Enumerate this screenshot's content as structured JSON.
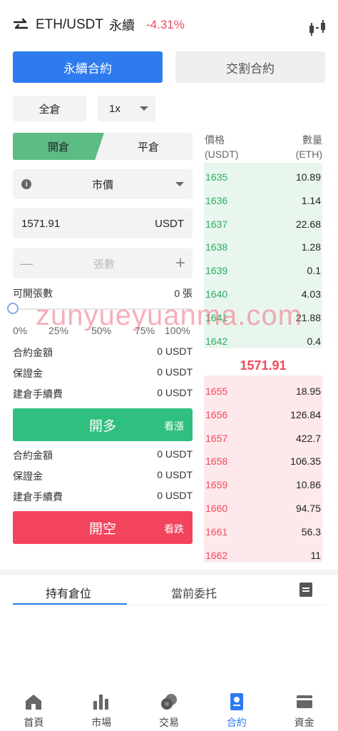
{
  "header": {
    "pair": "ETH/USDT",
    "contract_type": "永續",
    "change": "-4.31%",
    "change_color": "#f04a5a"
  },
  "contract_tabs": [
    {
      "label": "永續合約",
      "active": true
    },
    {
      "label": "交割合約",
      "active": false
    }
  ],
  "margin_mode": "全倉",
  "leverage": "1x",
  "position_toggle": {
    "open": "開倉",
    "close": "平倉"
  },
  "order_type": "市價",
  "price_input": {
    "value": "1571.91",
    "unit": "USDT"
  },
  "quantity_input": {
    "placeholder": "張數",
    "minus": "—",
    "plus": "+"
  },
  "available": {
    "label": "可開張數",
    "value": "0 張"
  },
  "slider": {
    "percentages": [
      "0%",
      "25%",
      "50%",
      "75%",
      "100%"
    ],
    "value": 0
  },
  "long_summary": [
    {
      "label": "合約金額",
      "value": "0 USDT"
    },
    {
      "label": "保證金",
      "value": "0 USDT"
    },
    {
      "label": "建倉手續費",
      "value": "0 USDT"
    }
  ],
  "long_button": {
    "label": "開多",
    "sub": "看漲",
    "color": "#2fbf7e"
  },
  "short_summary": [
    {
      "label": "合約金額",
      "value": "0 USDT"
    },
    {
      "label": "保證金",
      "value": "0 USDT"
    },
    {
      "label": "建倉手續費",
      "value": "0 USDT"
    }
  ],
  "short_button": {
    "label": "開空",
    "sub": "看跌",
    "color": "#f04a5a"
  },
  "orderbook": {
    "price_header": "價格",
    "price_unit": "(USDT)",
    "qty_header": "數量",
    "qty_unit": "(ETH)",
    "asks": [
      {
        "price": "1635",
        "qty": "10.89"
      },
      {
        "price": "1636",
        "qty": "1.14"
      },
      {
        "price": "1637",
        "qty": "22.68"
      },
      {
        "price": "1638",
        "qty": "1.28"
      },
      {
        "price": "1639",
        "qty": "0.1"
      },
      {
        "price": "1640",
        "qty": "4.03"
      },
      {
        "price": "1641",
        "qty": "21.88"
      },
      {
        "price": "1642",
        "qty": "0.4"
      }
    ],
    "mid_price": "1571.91",
    "bids": [
      {
        "price": "1655",
        "qty": "18.95"
      },
      {
        "price": "1656",
        "qty": "126.84"
      },
      {
        "price": "1657",
        "qty": "422.7"
      },
      {
        "price": "1658",
        "qty": "106.35"
      },
      {
        "price": "1659",
        "qty": "10.86"
      },
      {
        "price": "1660",
        "qty": "94.75"
      },
      {
        "price": "1661",
        "qty": "56.3"
      },
      {
        "price": "1662",
        "qty": "11"
      }
    ],
    "ask_color": "#2fa864",
    "bid_color": "#f04a5a"
  },
  "bottom_tabs": [
    {
      "label": "持有倉位",
      "active": true
    },
    {
      "label": "當前委托",
      "active": false
    }
  ],
  "nav": [
    {
      "label": "首頁",
      "icon": "home-icon",
      "active": false
    },
    {
      "label": "市場",
      "icon": "chart-icon",
      "active": false
    },
    {
      "label": "交易",
      "icon": "coins-icon",
      "active": false
    },
    {
      "label": "合約",
      "icon": "contract-icon",
      "active": true
    },
    {
      "label": "資金",
      "icon": "wallet-icon",
      "active": false
    }
  ],
  "watermark": "zunyueyuanma.com",
  "accent_color": "#2e7bf0"
}
